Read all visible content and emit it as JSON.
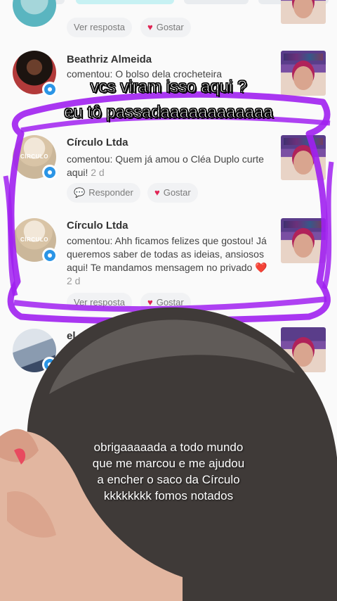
{
  "top_caption": {
    "line1": "vcs viram isso aqui ?",
    "line2": "eu tô passadaaaaaaaaaaaa"
  },
  "comments": [
    {
      "name": "",
      "text": "",
      "reply_label": "Ver resposta",
      "like_label": "Gostar"
    },
    {
      "name": "Beathriz Almeida",
      "text": "comentou: O bolso dela crocheteira"
    },
    {
      "name": "Círculo Ltda",
      "text": "comentou: Quem já amou o Cléa Duplo curte aqui!",
      "time": "2 d",
      "reply_label": "Responder",
      "like_label": "Gostar"
    },
    {
      "name": "Círculo Ltda",
      "text": "comentou: Ahh ficamos felizes que gostou! Já queremos saber de todas as ideias, ansiosos aqui! Te mandamos mensagem no privado",
      "time": "2 d",
      "reply_label": "Ver resposta",
      "like_label": "Gostar"
    },
    {
      "name": "el"
    }
  ],
  "overlay_caption": {
    "lines": [
      "obrigaaaaada a todo mundo",
      "que me marcou e me ajudou",
      "a encher o saco da Círculo",
      "kkkkkkkk fomos notados"
    ]
  },
  "colors": {
    "scribble": "#a020f0",
    "verified": "#2b95e6",
    "heart": "#e02454"
  },
  "icons": {
    "heart": "heart-icon",
    "reply": "speech-bubble-icon",
    "verified": "verified-badge-icon",
    "heart_emoji": "red-heart-emoji-icon"
  }
}
